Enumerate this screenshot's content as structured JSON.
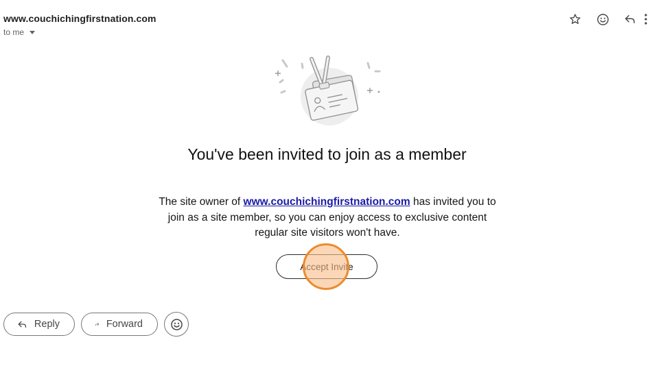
{
  "email": {
    "sender": "www.couchichingfirstnation.com",
    "recipient_label": "to me"
  },
  "header_actions": [
    {
      "name": "star-icon"
    },
    {
      "name": "emoji-reaction-icon"
    },
    {
      "name": "reply-icon"
    },
    {
      "name": "more-options-icon"
    }
  ],
  "content": {
    "headline": "You've been invited to join as a member",
    "body_prefix": "The site owner of ",
    "body_link": "www.couchichingfirstnation.com",
    "body_suffix": " has invited you to join as a site member, so you can enjoy access to exclusive content regular site visitors won't have.",
    "cta_label": "Accept Invite"
  },
  "bottom_actions": {
    "reply_label": "Reply",
    "forward_label": "Forward"
  },
  "colors": {
    "link": "#1a1aa6",
    "click_marker": "#ee8a2b"
  }
}
